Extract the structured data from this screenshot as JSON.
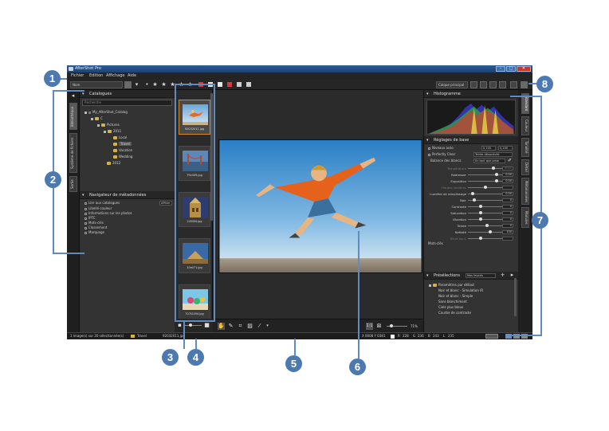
{
  "window": {
    "title": "AfterShot Pro"
  },
  "menu": [
    "Fichier",
    "Edition",
    "Affichage",
    "Aide"
  ],
  "toolbar": {
    "sort_select": "Nom",
    "layout_select": "Calque principal"
  },
  "left_tabs": [
    "Bibliothèque",
    "Système de fichiers",
    "Sortie"
  ],
  "catalogs": {
    "title": "Catalogues",
    "search_placeholder": "Recherche",
    "tree": [
      {
        "label": "My_AfterShot_Catalog",
        "level": 0,
        "kind": "catalog"
      },
      {
        "label": "C",
        "level": 1,
        "kind": "folder"
      },
      {
        "label": "Pictures",
        "level": 2,
        "kind": "folder"
      },
      {
        "label": "2011",
        "level": 3,
        "kind": "folder"
      },
      {
        "label": "Local",
        "level": 4,
        "kind": "folder"
      },
      {
        "label": "Travel",
        "level": 4,
        "kind": "folder",
        "selected": true
      },
      {
        "label": "Vacation",
        "level": 4,
        "kind": "folder"
      },
      {
        "label": "Wedding",
        "level": 4,
        "kind": "folder"
      },
      {
        "label": "2012",
        "level": 3,
        "kind": "folder"
      }
    ]
  },
  "metadata_nav": {
    "title": "Navigateur de métadonnées",
    "link_label": "Lier aux catalogues",
    "button": "Affiner",
    "items": [
      "Libellé couleur",
      "Informations sur les photos",
      "IPTC",
      "Mots-clés",
      "Classement",
      "Marquage"
    ]
  },
  "filmstrip": {
    "thumbs": [
      {
        "caption": "92032011.jpg",
        "selected": true
      },
      {
        "caption": "79c009.jpg",
        "selected": false
      },
      {
        "caption": "24308t.jpg",
        "selected": false
      },
      {
        "caption": "10z071.jpg",
        "selected": false
      },
      {
        "caption": "707t2494.jpg",
        "selected": false
      }
    ]
  },
  "viewer": {
    "zoom": "71%"
  },
  "histogram": {
    "title": "Histogramme"
  },
  "basic_adjustments": {
    "title": "Réglages de base",
    "auto_levels": {
      "label": "Niveaux auto.",
      "low": "0,100",
      "high": "0,100"
    },
    "perfect_clear": {
      "label": "Perfectly Clear",
      "value": "Teinte désactivée"
    },
    "white_balance": {
      "label": "Balance des blancs",
      "value": "En tant que prise"
    },
    "sliders": [
      {
        "label": "Température",
        "value": "5021",
        "dim": true
      },
      {
        "label": "Redresser",
        "value": "0,00",
        "dim": false
      },
      {
        "label": "Exposition",
        "value": "0,00",
        "dim": false
      },
      {
        "label": "Hautes lumières",
        "value": "",
        "dim": true
      },
      {
        "label": "Lumière de remplissage",
        "value": "0,00",
        "dim": false
      },
      {
        "label": "Noir",
        "value": "0",
        "dim": false
      },
      {
        "label": "Contraste",
        "value": "0",
        "dim": false
      },
      {
        "label": "Saturation",
        "value": "0",
        "dim": false
      },
      {
        "label": "Vibration",
        "value": "0",
        "dim": false
      },
      {
        "label": "Teinte",
        "value": "0",
        "dim": false
      },
      {
        "label": "Netteté",
        "value": "100",
        "dim": false
      },
      {
        "label": "Bruit boul.",
        "value": "",
        "dim": true
      }
    ],
    "keywords_label": "Mots-clés"
  },
  "presets": {
    "title": "Présélections",
    "filter": "Mes favoris",
    "root": "Paramètres par défaut",
    "items": [
      "Noir et blanc - Simulation IR",
      "Noir et blanc - Simple",
      "Sans blanchiment",
      "Ciels plus bleus",
      "Courbe de contraste"
    ]
  },
  "right_tabs": [
    "Standard",
    "Couleur",
    "Tonalité",
    "Détail",
    "Métadonnées",
    "Modules"
  ],
  "status": {
    "selection": "1 image(s) sur 20 sélectionnée(s)",
    "folder": "Travel",
    "file": "92032011.jpg",
    "coords": "X 0008 Y 0381",
    "r_label": "R",
    "r_value": "228",
    "g_label": "G",
    "g_value": "236",
    "b_label": "B",
    "b_value": "243",
    "l_label": "L",
    "l_value": "235"
  },
  "callouts": [
    "1",
    "2",
    "3",
    "4",
    "5",
    "6",
    "7",
    "8"
  ],
  "colors": {
    "accent": "#4c79b0",
    "selection": "#d08a2a",
    "bg": "#2d2d2d"
  }
}
